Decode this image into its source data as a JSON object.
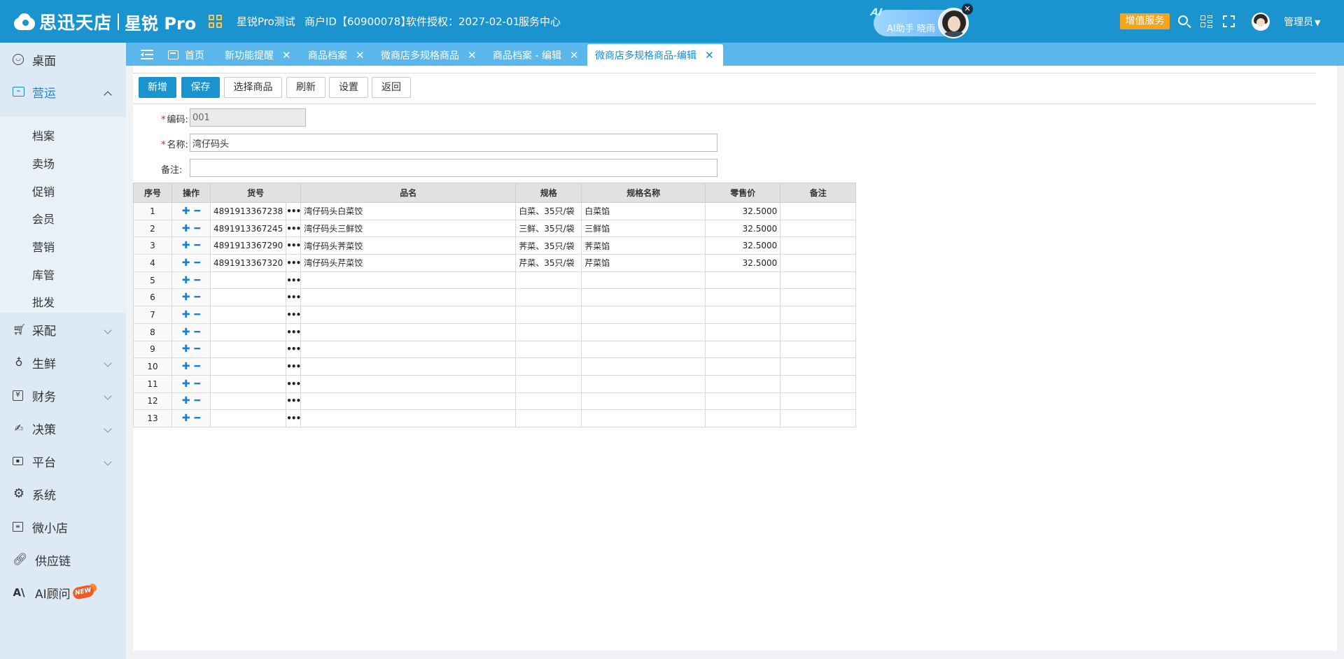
{
  "header": {
    "logo_brand": "思迅天店",
    "logo_product": "星锐 Pro",
    "store_name": "星锐Pro测试",
    "merchant_id": "商户ID【60900078】",
    "license": "软件授权：2027-02-01",
    "service_center": "服务中心",
    "ai_assistant": "AI助手 晓雨",
    "ai_logo": "AI",
    "value_added": "增值服务",
    "user": "管理员"
  },
  "sidebar": {
    "items": [
      {
        "label": "桌面",
        "icon": "desktop-icon"
      },
      {
        "label": "营运",
        "icon": "operations-icon",
        "expanded": true
      },
      {
        "label": "采配",
        "icon": "cart-icon"
      },
      {
        "label": "生鲜",
        "icon": "fresh-icon"
      },
      {
        "label": "财务",
        "icon": "yen-icon"
      },
      {
        "label": "决策",
        "icon": "decision-icon"
      },
      {
        "label": "平台",
        "icon": "platform-icon"
      },
      {
        "label": "系统",
        "icon": "gear-icon"
      },
      {
        "label": "微小店",
        "icon": "shop-icon"
      },
      {
        "label": "供应链",
        "icon": "link-icon"
      },
      {
        "label": "AI顾问",
        "icon": "ai-icon",
        "badge": "NEW"
      }
    ],
    "sub_items": [
      "档案",
      "卖场",
      "促销",
      "会员",
      "营销",
      "库管",
      "批发"
    ]
  },
  "tabs": [
    {
      "label": "首页",
      "closable": false
    },
    {
      "label": "新功能提醒",
      "closable": true
    },
    {
      "label": "商品档案",
      "closable": true
    },
    {
      "label": "微商店多规格商品",
      "closable": true
    },
    {
      "label": "商品档案 - 编辑",
      "closable": true
    },
    {
      "label": "微商店多规格商品-编辑",
      "closable": true,
      "active": true
    }
  ],
  "toolbar": {
    "add": "新增",
    "save": "保存",
    "select_product": "选择商品",
    "refresh": "刷新",
    "settings": "设置",
    "back": "返回"
  },
  "form": {
    "code_label": "编码:",
    "code_value": "001",
    "name_label": "名称:",
    "name_value": "湾仔码头",
    "remark_label": "备注:",
    "remark_value": ""
  },
  "grid": {
    "headers": [
      "序号",
      "操作",
      "货号",
      "品名",
      "规格",
      "规格名称",
      "零售价",
      "备注"
    ],
    "rows": [
      {
        "idx": "1",
        "code": "4891913367238",
        "name": "湾仔码头白菜饺",
        "spec": "白菜、35只/袋",
        "spec_name": "白菜馅",
        "price": "32.5000",
        "remark": ""
      },
      {
        "idx": "2",
        "code": "4891913367245",
        "name": "湾仔码头三鲜饺",
        "spec": "三鲜、35只/袋",
        "spec_name": "三鲜馅",
        "price": "32.5000",
        "remark": ""
      },
      {
        "idx": "3",
        "code": "4891913367290",
        "name": "湾仔码头荠菜饺",
        "spec": "荠菜、35只/袋",
        "spec_name": "荠菜馅",
        "price": "32.5000",
        "remark": ""
      },
      {
        "idx": "4",
        "code": "4891913367320",
        "name": "湾仔码头芹菜饺",
        "spec": "芹菜、35只/袋",
        "spec_name": "芹菜馅",
        "price": "32.5000",
        "remark": ""
      },
      {
        "idx": "5",
        "code": "",
        "name": "",
        "spec": "",
        "spec_name": "",
        "price": "",
        "remark": ""
      },
      {
        "idx": "6",
        "code": "",
        "name": "",
        "spec": "",
        "spec_name": "",
        "price": "",
        "remark": ""
      },
      {
        "idx": "7",
        "code": "",
        "name": "",
        "spec": "",
        "spec_name": "",
        "price": "",
        "remark": ""
      },
      {
        "idx": "8",
        "code": "",
        "name": "",
        "spec": "",
        "spec_name": "",
        "price": "",
        "remark": ""
      },
      {
        "idx": "9",
        "code": "",
        "name": "",
        "spec": "",
        "spec_name": "",
        "price": "",
        "remark": ""
      },
      {
        "idx": "10",
        "code": "",
        "name": "",
        "spec": "",
        "spec_name": "",
        "price": "",
        "remark": ""
      },
      {
        "idx": "11",
        "code": "",
        "name": "",
        "spec": "",
        "spec_name": "",
        "price": "",
        "remark": ""
      },
      {
        "idx": "12",
        "code": "",
        "name": "",
        "spec": "",
        "spec_name": "",
        "price": "",
        "remark": ""
      },
      {
        "idx": "13",
        "code": "",
        "name": "",
        "spec": "",
        "spec_name": "",
        "price": "",
        "remark": ""
      }
    ]
  },
  "colors": {
    "header_bg": "#1a93cf",
    "tabbar_bg": "#5bb6eb",
    "sidebar_bg": "#dde9f5",
    "accent": "#1a8bd1",
    "value_added_bg": "#f5a31a"
  }
}
